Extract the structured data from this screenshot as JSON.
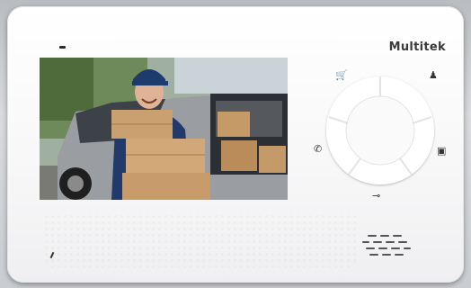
{
  "brand": {
    "name": "Multitek"
  },
  "icons": {
    "top_left": "store-basket-icon",
    "top_right": "intercom-person-icon",
    "left": "phone-handset-icon",
    "right": "picture-gallery-icon",
    "bottom": "key-door-unlock-icon"
  },
  "colors": {
    "device_body": "#f7f7f8",
    "brand_text": "#3a3a3a",
    "screen_bezel": "#1a1a1a"
  }
}
